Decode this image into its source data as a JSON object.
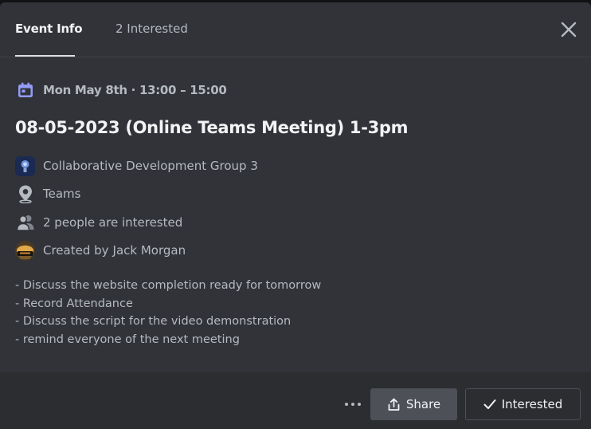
{
  "tabs": [
    {
      "label": "Event Info",
      "active": true
    },
    {
      "label": "2 Interested",
      "active": false
    }
  ],
  "event": {
    "datetime": "Mon May 8th · 13:00 – 15:00",
    "title": "08-05-2023 (Online Teams Meeting) 1-3pm",
    "server": "Collaborative Development Group 3",
    "location": "Teams",
    "interested_text": "2 people are interested",
    "created_by_prefix": "Created by",
    "creator": "Jack Morgan",
    "description": [
      "- Discuss the website completion ready for tomorrow",
      "- Record Attendance",
      "- Discuss the script for the video demonstration",
      "- remind everyone of the next meeting"
    ]
  },
  "footer": {
    "share_label": "Share",
    "interested_label": "Interested"
  },
  "colors": {
    "background": "#313338",
    "footer": "#2b2d31",
    "accent_calendar": "#949cf7",
    "creator_link": "#00e5c6"
  },
  "icons": [
    "close-icon",
    "calendar-icon",
    "server-icon",
    "location-pin-icon",
    "people-icon",
    "avatar",
    "more-icon",
    "share-icon",
    "checkmark-icon"
  ]
}
